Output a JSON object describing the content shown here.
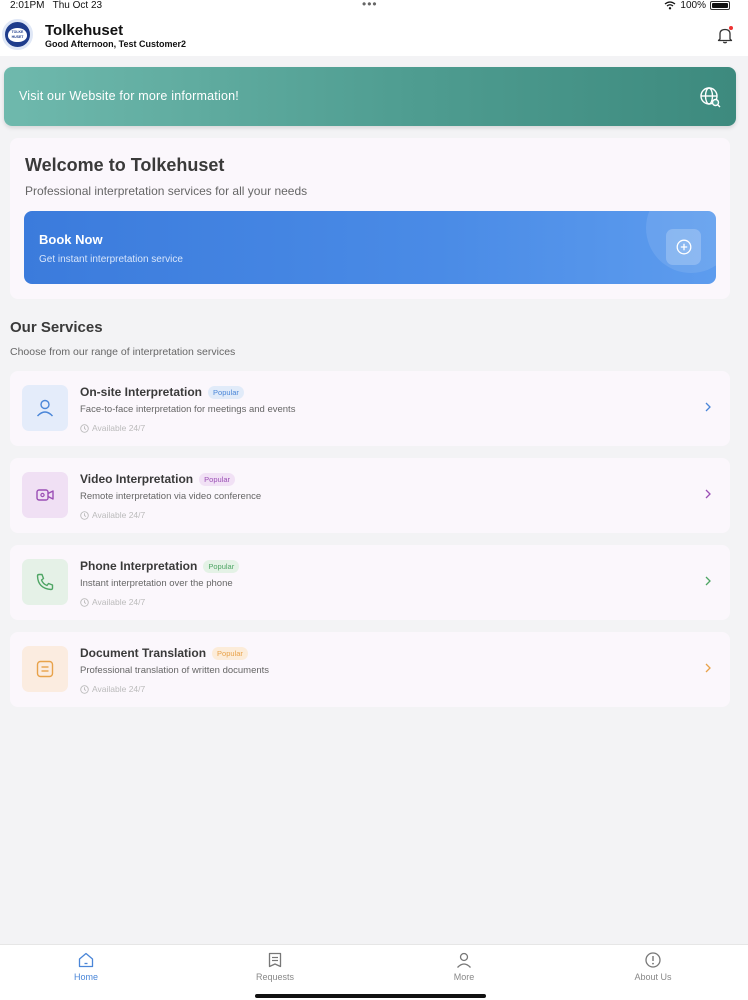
{
  "status_bar": {
    "time": "2:01PM",
    "date": "Thu Oct 23",
    "dots": "•••",
    "battery": "100%"
  },
  "header": {
    "logo_text": "TOLKE HUSET",
    "title": "Tolkehuset",
    "greeting": "Good Afternoon, Test Customer2"
  },
  "banner": {
    "text": "Visit our Website for more information!"
  },
  "welcome": {
    "title": "Welcome to Tolkehuset",
    "subtitle": "Professional interpretation services for all your needs",
    "book": {
      "title": "Book Now",
      "subtitle": "Get instant interpretation service"
    }
  },
  "services": {
    "title": "Our Services",
    "subtitle": "Choose from our range of interpretation services",
    "items": [
      {
        "title": "On-site Interpretation",
        "badge": "Popular",
        "description": "Face-to-face interpretation for meetings and events",
        "availability": "Available 24/7",
        "icon": "person-icon",
        "accent": "#4a86d8",
        "icon_bg": "#e4ecfa",
        "badge_bg": "#e1ebf9"
      },
      {
        "title": "Video Interpretation",
        "badge": "Popular",
        "description": "Remote interpretation via video conference",
        "availability": "Available 24/7",
        "icon": "video-icon",
        "accent": "#9b4fb5",
        "icon_bg": "#f0e0f4",
        "badge_bg": "#f1e1f5"
      },
      {
        "title": "Phone Interpretation",
        "badge": "Popular",
        "description": "Instant interpretation over the phone",
        "availability": "Available 24/7",
        "icon": "phone-icon",
        "accent": "#4ea564",
        "icon_bg": "#e5f1e7",
        "badge_bg": "#e4f2e6"
      },
      {
        "title": "Document Translation",
        "badge": "Popular",
        "description": "Professional translation of written documents",
        "availability": "Available 24/7",
        "icon": "document-icon",
        "accent": "#e8a24a",
        "icon_bg": "#fbece0",
        "badge_bg": "#fcecd9"
      }
    ]
  },
  "nav": {
    "items": [
      {
        "label": "Home",
        "icon": "home-icon",
        "active": true
      },
      {
        "label": "Requests",
        "icon": "requests-icon",
        "active": false
      },
      {
        "label": "More",
        "icon": "person-icon",
        "active": false
      },
      {
        "label": "About Us",
        "icon": "info-icon",
        "active": false
      }
    ]
  }
}
